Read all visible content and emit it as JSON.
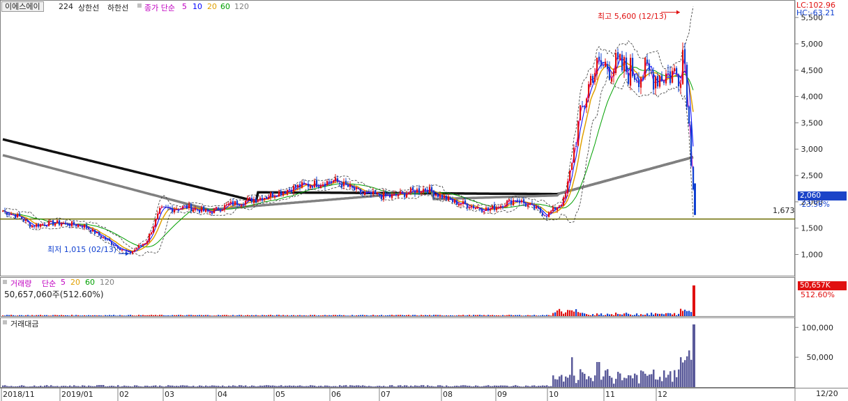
{
  "header": {
    "stock_name": "이에스에이",
    "code_info": "224",
    "upper_limit": "상한선",
    "lower_limit": "하한선",
    "ma_label": "종가 단순",
    "ma_periods": [
      "5",
      "10",
      "20",
      "60",
      "120"
    ],
    "ma_colors": [
      "#c000c0",
      "#0000ff",
      "#e0a000",
      "#00a000",
      "#808080"
    ],
    "lc": "LC:102.96",
    "hc": "HC:-63.21"
  },
  "price_panel": {
    "high_annotation": "최고 5,600 (12/13)",
    "low_annotation": "최저 1,015 (02/13)",
    "hline_label": "1,673",
    "hline_value": 1673,
    "current_price": "2,060",
    "change_pct": "-23.56%",
    "y_ticks": [
      "1,000",
      "1,500",
      "2,000",
      "2,500",
      "3,000",
      "3,500",
      "4,000",
      "4,500",
      "5,000",
      "5,500"
    ],
    "ylim": [
      650,
      5700
    ]
  },
  "volume_panel": {
    "label": "거래량",
    "ma_label": "단순",
    "ma_periods": [
      "5",
      "20",
      "60",
      "120"
    ],
    "ma_colors": [
      "#c000c0",
      "#e0a000",
      "#00a000",
      "#808080"
    ],
    "volume_text": "50,657,060주(512.60%)",
    "volume_tag": "50,657K",
    "pct_tag": "512.60%"
  },
  "amount_panel": {
    "label": "거래대금",
    "y_ticks": [
      "50,000",
      "100,000"
    ],
    "ylim": [
      0,
      112000
    ]
  },
  "x_axis": {
    "labels": [
      "2018/11",
      "2019/01",
      "02",
      "03",
      "04",
      "05",
      "06",
      "07",
      "08",
      "09",
      "10",
      "11",
      "12"
    ],
    "right_label": "12/20"
  },
  "colors": {
    "up": "#e01010",
    "down": "#1040d0",
    "hline": "#6b6b00"
  },
  "chart_data": [
    {
      "type": "candlestick",
      "title": "이에스에이",
      "x_range": [
        "2018/11",
        "2019/12/20"
      ],
      "ylim": [
        650,
        5700
      ],
      "series": [
        {
          "name": "종가",
          "x": [
            "2018/11",
            "2018/12",
            "2019/01",
            "2019/02",
            "2019/02/13",
            "2019/03",
            "2019/04",
            "2019/05",
            "2019/06",
            "2019/07",
            "2019/08",
            "2019/09",
            "2019/10",
            "2019/11",
            "2019/12",
            "2019/12/13",
            "2019/12/20"
          ],
          "values": [
            1850,
            1600,
            1650,
            1250,
            1015,
            1900,
            1800,
            2150,
            2400,
            2100,
            1950,
            1800,
            1750,
            4500,
            4400,
            5600,
            2060
          ]
        }
      ],
      "max": {
        "date": "12/13",
        "value": 5600
      },
      "min": {
        "date": "02/13",
        "value": 1015
      }
    },
    {
      "type": "bar",
      "title": "거래량",
      "x": [
        "2019/10",
        "2019/11",
        "2019/12",
        "2019/12/20"
      ],
      "values_pct": [
        35,
        15,
        12,
        512.6
      ],
      "latest": "50,657,060"
    },
    {
      "type": "bar",
      "title": "거래대금",
      "x": [
        "2018/11",
        "2019/01",
        "2019/03",
        "2019/05",
        "2019/07",
        "2019/09",
        "2019/10",
        "2019/10/25",
        "2019/11",
        "2019/12",
        "2019/12/19",
        "2019/12/20"
      ],
      "values": [
        2000,
        4000,
        2000,
        5000,
        4000,
        3000,
        8000,
        50000,
        30000,
        12000,
        60000,
        105000
      ],
      "ylim": [
        0,
        112000
      ]
    }
  ]
}
